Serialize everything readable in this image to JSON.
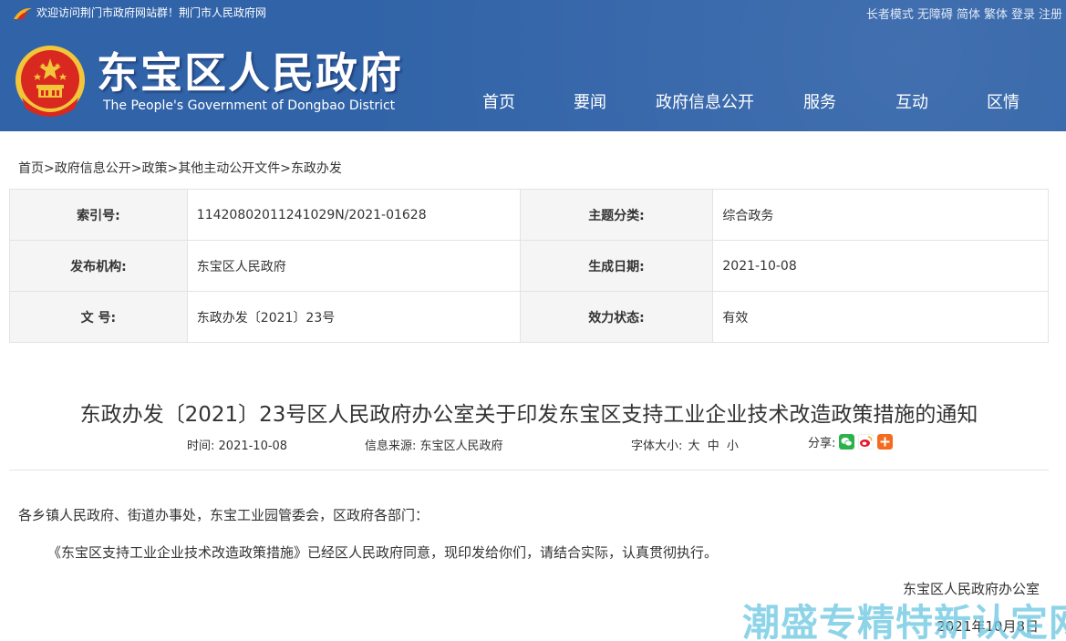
{
  "header": {
    "welcome_text": "欢迎访问荆门市政府网站群！荆门市人民政府网",
    "top_links": [
      "长者模式",
      "无障碍",
      "简体",
      "繁体",
      "登录",
      "注册"
    ],
    "site_title": "东宝区人民政府",
    "site_subtitle": "The People's Government of Dongbao District",
    "nav": [
      "首页",
      "要闻",
      "政府信息公开",
      "服务",
      "互动",
      "区情"
    ],
    "colors": {
      "header_bg": "#3163a8",
      "emblem_red": "#d8281f",
      "emblem_gold": "#f3c63a"
    }
  },
  "breadcrumb": {
    "items": [
      "首页",
      "政府信息公开",
      "政策",
      "其他主动公开文件",
      "东政办发"
    ],
    "separator": ">"
  },
  "meta": {
    "rows": [
      {
        "l1": "索引号:",
        "v1": "11420802011241029N/2021-01628",
        "l2": "主题分类:",
        "v2": "综合政务"
      },
      {
        "l1": "发布机构:",
        "v1": "东宝区人民政府",
        "l2": "生成日期:",
        "v2": "2021-10-08"
      },
      {
        "l1": "文 号:",
        "v1": "东政办发〔2021〕23号",
        "l2": "效力状态:",
        "v2": "有效"
      }
    ]
  },
  "article": {
    "title": "东政办发〔2021〕23号区人民政府办公室关于印发东宝区支持工业企业技术改造政策措施的通知",
    "time_label": "时间:",
    "time_value": "2021-10-08",
    "source_label": "信息来源:",
    "source_value": "东宝区人民政府",
    "font_size_label": "字体大小:",
    "font_size_options": [
      "大",
      "中",
      "小"
    ],
    "share_label": "分享:",
    "share_icons": [
      "wechat-icon",
      "weibo-icon",
      "more-share-icon"
    ],
    "salutation": "各乡镇人民政府、街道办事处，东宝工业园管委会，区政府各部门：",
    "body": "《东宝区支持工业企业技术改造政策措施》已经区人民政府同意，现印发给你们，请结合实际，认真贯彻执行。",
    "signature": "东宝区人民政府办公室",
    "date": "2021年10月8日"
  },
  "watermark": "潮盛专精特新认定网"
}
